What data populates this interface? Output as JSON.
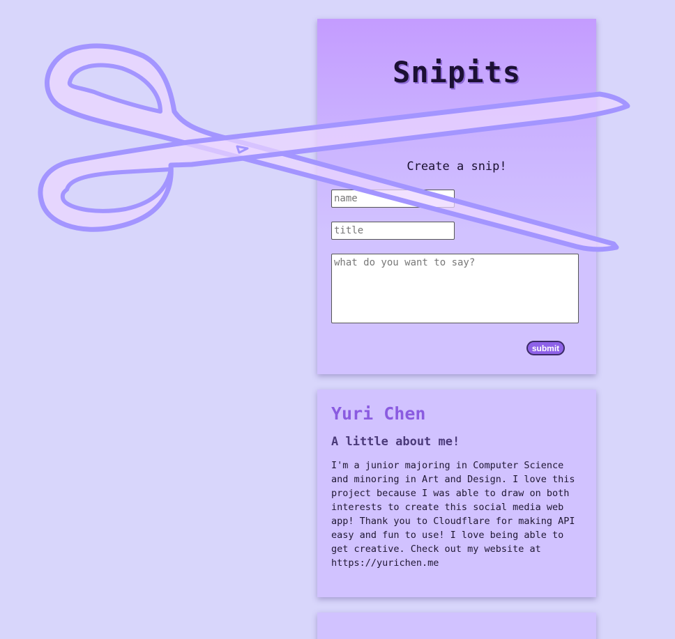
{
  "app": {
    "title": "Snipits"
  },
  "form": {
    "heading": "Create a snip!",
    "name_placeholder": "name",
    "title_placeholder": "title",
    "body_placeholder": "what do you want to say?",
    "submit_label": "submit"
  },
  "posts": [
    {
      "author": "Yuri Chen",
      "title": "A little about me!",
      "body": "I'm a junior majoring in Computer Science and minoring in Art and Design. I love this project because I was able to draw on both interests to create this social media web app! Thank you to Cloudflare for making API easy and fun to use! I love being able to get creative. Check out my website at https://yurichen.me"
    }
  ],
  "colors": {
    "background": "#d8d6fb",
    "card": "#d1c2ff",
    "accent": "#8a5be0",
    "scissors_fill": "#ecd6ff",
    "scissors_stroke": "#a395ff"
  },
  "icons": {
    "decoration": "scissors-icon"
  }
}
